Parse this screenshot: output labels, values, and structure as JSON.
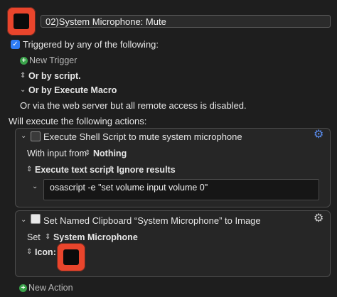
{
  "macro": {
    "name": "02)System Microphone: Mute"
  },
  "triggers": {
    "checkbox_label": "Triggered by any of the following:",
    "new_trigger": "New Trigger",
    "or_by_script": "Or by script.",
    "or_by_execute_macro": "Or by Execute Macro",
    "web_server_note": "Or via the web server but all remote access is disabled."
  },
  "actions": {
    "heading": "Will execute the following actions:",
    "shell": {
      "title": "Execute Shell Script to mute system microphone",
      "with_input_label": "With input from",
      "with_input_value": "Nothing",
      "execute_option": "Execute text script",
      "results_option": "Ignore results",
      "script": "osascript -e \"set volume input volume 0\""
    },
    "clipboard": {
      "title": "Set Named Clipboard “System Microphone” to Image",
      "set_label": "Set",
      "set_value": "System Microphone",
      "icon_label": "Icon:"
    },
    "new_action": "New Action"
  },
  "colors": {
    "icon_red": "#e9452c",
    "accent_blue": "#2f7df6",
    "add_green": "#3aa24a"
  }
}
